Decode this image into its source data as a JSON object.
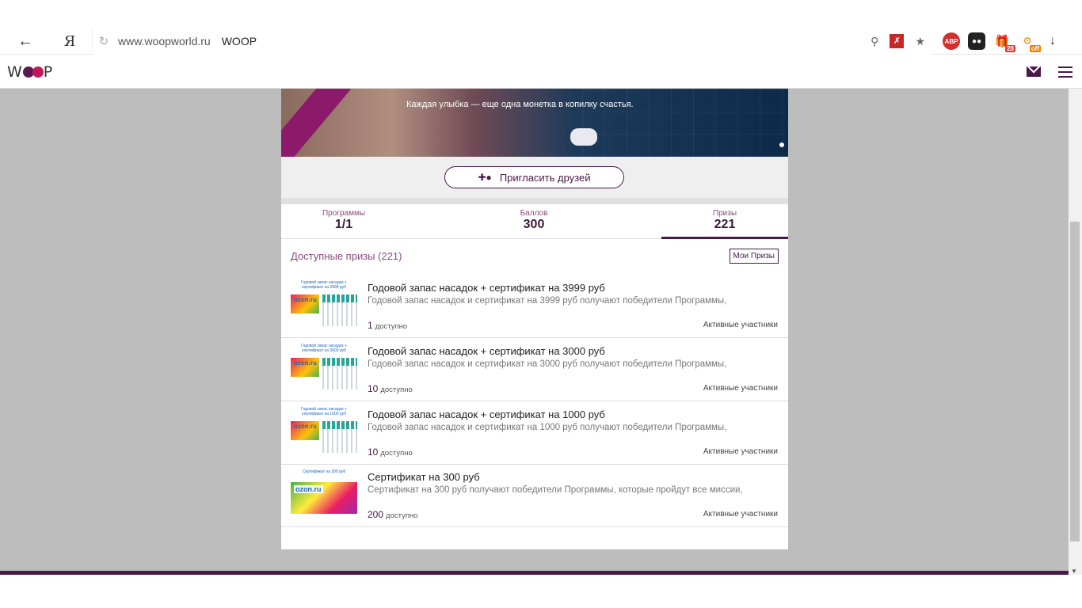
{
  "browser": {
    "url": "www.woopworld.ru",
    "title": "WOOP",
    "ya_label": "Я",
    "ext_abp": "ABP",
    "ext_gift_badge": "28",
    "ext_off_badge": "off"
  },
  "site": {
    "logo_w": "W",
    "logo_p": "P"
  },
  "banner": {
    "text": "Каждая улыбка — еще одна монетка в копилку счастья."
  },
  "invite": {
    "label": "Пригласить друзей"
  },
  "stats": [
    {
      "label": "Программы",
      "value": "1/1"
    },
    {
      "label": "Баллов",
      "value": "300"
    },
    {
      "label": "Призы",
      "value": "221"
    }
  ],
  "prizes_section": {
    "title": "Доступные призы (221)",
    "my_prizes": "Мои Призы"
  },
  "prizes": [
    {
      "thumb_title": "Годовой запас насадок + сертификат на 3999 руб",
      "thumb_brand": "ozon.ru",
      "title": "Годовой запас насадок + сертификат на 3999 руб",
      "desc": "Годовой запас насадок и сертификат на 3999 руб получают победители Программы,",
      "count": "1",
      "count_label": "доступно",
      "audience": "Активные участники"
    },
    {
      "thumb_title": "Годовой запас насадок + сертификат на 3000 руб",
      "thumb_brand": "ozon.ru",
      "title": "Годовой запас насадок + сертификат на 3000 руб",
      "desc": "Годовой запас насадок и сертификат на 3000 руб получают победители Программы,",
      "count": "10",
      "count_label": "доступно",
      "audience": "Активные участники"
    },
    {
      "thumb_title": "Годовой запас насадок + сертификат на 1000 руб",
      "thumb_brand": "ozon.ru",
      "title": "Годовой запас насадок + сертификат на 1000 руб",
      "desc": "Годовой запас насадок и сертификат на 1000 руб получают победители Программы,",
      "count": "10",
      "count_label": "доступно",
      "audience": "Активные участники"
    },
    {
      "thumb_title": "Сертификат на 300 руб",
      "thumb_brand": "ozon.ru",
      "title": "Сертификат на 300 руб",
      "desc": "Сертификат на 300 руб получают победители Программы, которые пройдут все миссии,",
      "count": "200",
      "count_label": "доступно",
      "audience": "Активные участники"
    }
  ],
  "colors": {
    "brand": "#4a1848",
    "accent": "#8a4a7f",
    "page_bg": "#bdbdbd"
  }
}
